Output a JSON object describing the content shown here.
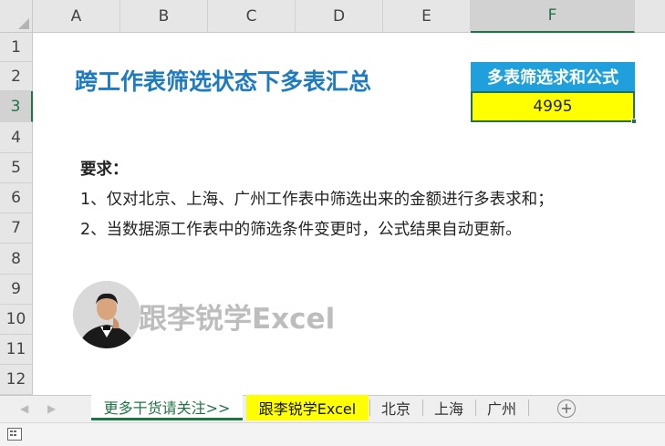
{
  "columns": [
    "A",
    "B",
    "C",
    "D",
    "E",
    "F"
  ],
  "rows": [
    "1",
    "2",
    "3",
    "4",
    "5",
    "6",
    "7",
    "8",
    "9",
    "10",
    "11",
    "12"
  ],
  "selected_column": "F",
  "selected_row": "3",
  "sheet": {
    "title": "跨工作表筛选状态下多表汇总",
    "formula_header": "多表筛选求和公式",
    "formula_value": "4995",
    "requirements_heading": "要求：",
    "requirement_1": "1、仅对北京、上海、广州工作表中筛选出来的金额进行多表求和；",
    "requirement_2": "2、当数据源工作表中的筛选条件变更时，公式结果自动更新。",
    "watermark": "跟李锐学Excel"
  },
  "tabs": [
    "更多干货请关注>>",
    "跟李锐学Excel",
    "北京",
    "上海",
    "广州"
  ],
  "colors": {
    "title": "#1e7bc1",
    "header_fill": "#1fa0dd",
    "highlight": "#ffff00",
    "excel_green": "#217346"
  }
}
